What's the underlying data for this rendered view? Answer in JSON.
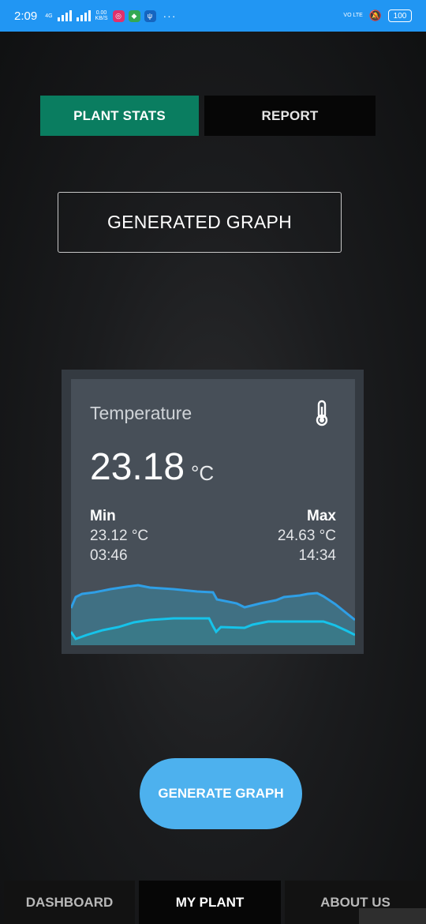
{
  "status_bar": {
    "time": "2:09",
    "network_label": "4G",
    "data_speed_value": "0.00",
    "data_speed_unit": "KB/S",
    "more_indicator": "···",
    "volte_label": "VO LTE",
    "battery": "100",
    "color": "#2196f3"
  },
  "tabs": [
    {
      "label": "PLANT STATS",
      "active": true
    },
    {
      "label": "REPORT",
      "active": false
    }
  ],
  "section_label": "GENERATED GRAPH",
  "widget": {
    "title": "Temperature",
    "icon": "thermometer-icon",
    "current_value": "23.18",
    "current_unit": "°C",
    "min_label": "Min",
    "min_value": "23.12 °C",
    "min_time": "03:46",
    "max_label": "Max",
    "max_value": "24.63 °C",
    "max_time": "14:34"
  },
  "generate_button": {
    "label": "GENERATE GRAPH",
    "color": "#4db1ee"
  },
  "bottom_nav": [
    {
      "label": "DASHBOARD",
      "active": false
    },
    {
      "label": "MY PLANT",
      "active": true
    },
    {
      "label": "ABOUT US",
      "active": false
    }
  ],
  "accent_color": "#0a7d60"
}
